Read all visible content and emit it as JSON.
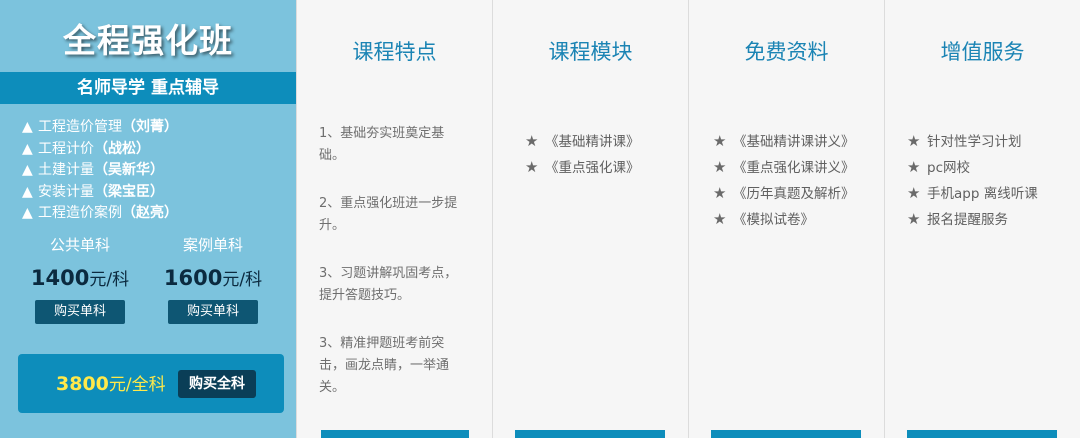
{
  "left_panel": {
    "title": "全程强化班",
    "subtitle": "名师导学 重点辅导",
    "teachers": [
      {
        "bullet": "▲",
        "course": "工程造价管理",
        "name": "（刘菁）"
      },
      {
        "bullet": "▲",
        "course": "工程计价",
        "name": "（战松）"
      },
      {
        "bullet": "▲",
        "course": "土建计量",
        "name": "（吴新华）"
      },
      {
        "bullet": "▲",
        "course": "安装计量",
        "name": "（梁宝臣）"
      },
      {
        "bullet": "▲",
        "course": "工程造价案例",
        "name": "（赵亮）"
      }
    ],
    "prices": [
      {
        "label": "公共单科",
        "amount": "1400",
        "unit": "元/科",
        "button": "购买单科"
      },
      {
        "label": "案例单科",
        "amount": "1600",
        "unit": "元/科",
        "button": "购买单科"
      }
    ],
    "full": {
      "amount": "3800",
      "unit": "元/全科",
      "button": "购买全科"
    }
  },
  "columns": {
    "features": {
      "title": "课程特点",
      "items": [
        "1、基础夯实班奠定基础。",
        "2、重点强化班进一步提升。",
        "3、习题讲解巩固考点，提升答题技巧。",
        "3、精准押题班考前突击，画龙点睛，一举通关。"
      ]
    },
    "modules": {
      "title": "课程模块",
      "star": "★",
      "items": [
        "《基础精讲课》",
        "《重点强化课》"
      ]
    },
    "materials": {
      "title": "免费资料",
      "star": "★",
      "items": [
        "《基础精讲课讲义》",
        "《重点强化课讲义》",
        "《历年真题及解析》",
        "《模拟试卷》"
      ]
    },
    "services": {
      "title": "增值服务",
      "star": "★",
      "items": [
        "针对性学习计划",
        "pc网校",
        "手机app 离线听课",
        "报名提醒服务"
      ]
    }
  },
  "colors": {
    "left_bg": "#7cc3dd",
    "accent_blue": "#0d8dbb",
    "dark_button": "#0e5673",
    "title_blue": "#1b84b4",
    "price_yellow": "#ffe94a"
  }
}
